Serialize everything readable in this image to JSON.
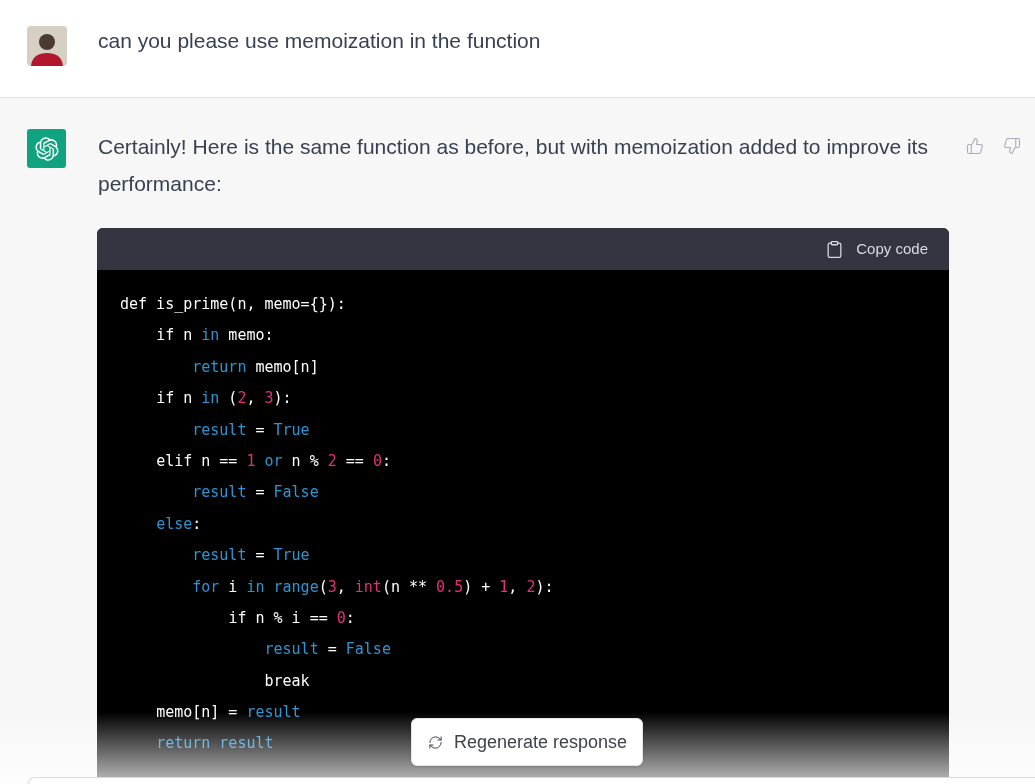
{
  "user_message": {
    "text": "can you please use memoization in the function"
  },
  "assistant_message": {
    "text": "Certainly! Here is the same function as before, but with memoization added to improve its performance:",
    "code_block": {
      "copy_button": "Copy code",
      "lines": [
        {
          "tokens": [
            {
              "kind": "plain",
              "text": "def is_prime(n, memo={}):"
            }
          ]
        },
        {
          "tokens": [
            {
              "kind": "plain",
              "text": "    if n "
            },
            {
              "kind": "keyword",
              "text": "in"
            },
            {
              "kind": "plain",
              "text": " memo:"
            }
          ]
        },
        {
          "tokens": [
            {
              "kind": "keyword",
              "text": "        return"
            },
            {
              "kind": "plain",
              "text": " memo[n]"
            }
          ]
        },
        {
          "tokens": [
            {
              "kind": "plain",
              "text": "    if n "
            },
            {
              "kind": "keyword",
              "text": "in"
            },
            {
              "kind": "plain",
              "text": " ("
            },
            {
              "kind": "number",
              "text": "2"
            },
            {
              "kind": "plain",
              "text": ", "
            },
            {
              "kind": "number",
              "text": "3"
            },
            {
              "kind": "plain",
              "text": "):"
            }
          ]
        },
        {
          "tokens": [
            {
              "kind": "keyword",
              "text": "        result"
            },
            {
              "kind": "plain",
              "text": " = "
            },
            {
              "kind": "keyword",
              "text": "True"
            }
          ]
        },
        {
          "tokens": [
            {
              "kind": "plain",
              "text": "    elif n == "
            },
            {
              "kind": "number",
              "text": "1"
            },
            {
              "kind": "keyword",
              "text": " or"
            },
            {
              "kind": "plain",
              "text": " n % "
            },
            {
              "kind": "number",
              "text": "2"
            },
            {
              "kind": "plain",
              "text": " == "
            },
            {
              "kind": "number",
              "text": "0"
            },
            {
              "kind": "plain",
              "text": ":"
            }
          ]
        },
        {
          "tokens": [
            {
              "kind": "keyword",
              "text": "        result"
            },
            {
              "kind": "plain",
              "text": " = "
            },
            {
              "kind": "keyword",
              "text": "False"
            }
          ]
        },
        {
          "tokens": [
            {
              "kind": "keyword",
              "text": "    else"
            },
            {
              "kind": "plain",
              "text": ":"
            }
          ]
        },
        {
          "tokens": [
            {
              "kind": "keyword",
              "text": "        result"
            },
            {
              "kind": "plain",
              "text": " = "
            },
            {
              "kind": "keyword",
              "text": "True"
            }
          ]
        },
        {
          "tokens": [
            {
              "kind": "keyword",
              "text": "        for"
            },
            {
              "kind": "plain",
              "text": " i "
            },
            {
              "kind": "keyword",
              "text": "in range"
            },
            {
              "kind": "plain",
              "text": "("
            },
            {
              "kind": "number",
              "text": "3"
            },
            {
              "kind": "plain",
              "text": ", "
            },
            {
              "kind": "builtin",
              "text": "int"
            },
            {
              "kind": "plain",
              "text": "(n ** "
            },
            {
              "kind": "number",
              "text": "0.5"
            },
            {
              "kind": "plain",
              "text": ") + "
            },
            {
              "kind": "number",
              "text": "1"
            },
            {
              "kind": "plain",
              "text": ", "
            },
            {
              "kind": "number",
              "text": "2"
            },
            {
              "kind": "plain",
              "text": "):"
            }
          ]
        },
        {
          "tokens": [
            {
              "kind": "plain",
              "text": "            if n % i == "
            },
            {
              "kind": "number",
              "text": "0"
            },
            {
              "kind": "plain",
              "text": ":"
            }
          ]
        },
        {
          "tokens": [
            {
              "kind": "keyword",
              "text": "                result"
            },
            {
              "kind": "plain",
              "text": " = "
            },
            {
              "kind": "keyword",
              "text": "False"
            }
          ]
        },
        {
          "tokens": [
            {
              "kind": "plain",
              "text": "                break"
            }
          ]
        },
        {
          "tokens": [
            {
              "kind": "plain",
              "text": "    memo[n] = "
            },
            {
              "kind": "keyword",
              "text": "result"
            }
          ]
        },
        {
          "tokens": [
            {
              "kind": "keyword",
              "text": "    return result"
            }
          ]
        }
      ]
    }
  },
  "regenerate_button": {
    "label": "Regenerate response"
  }
}
